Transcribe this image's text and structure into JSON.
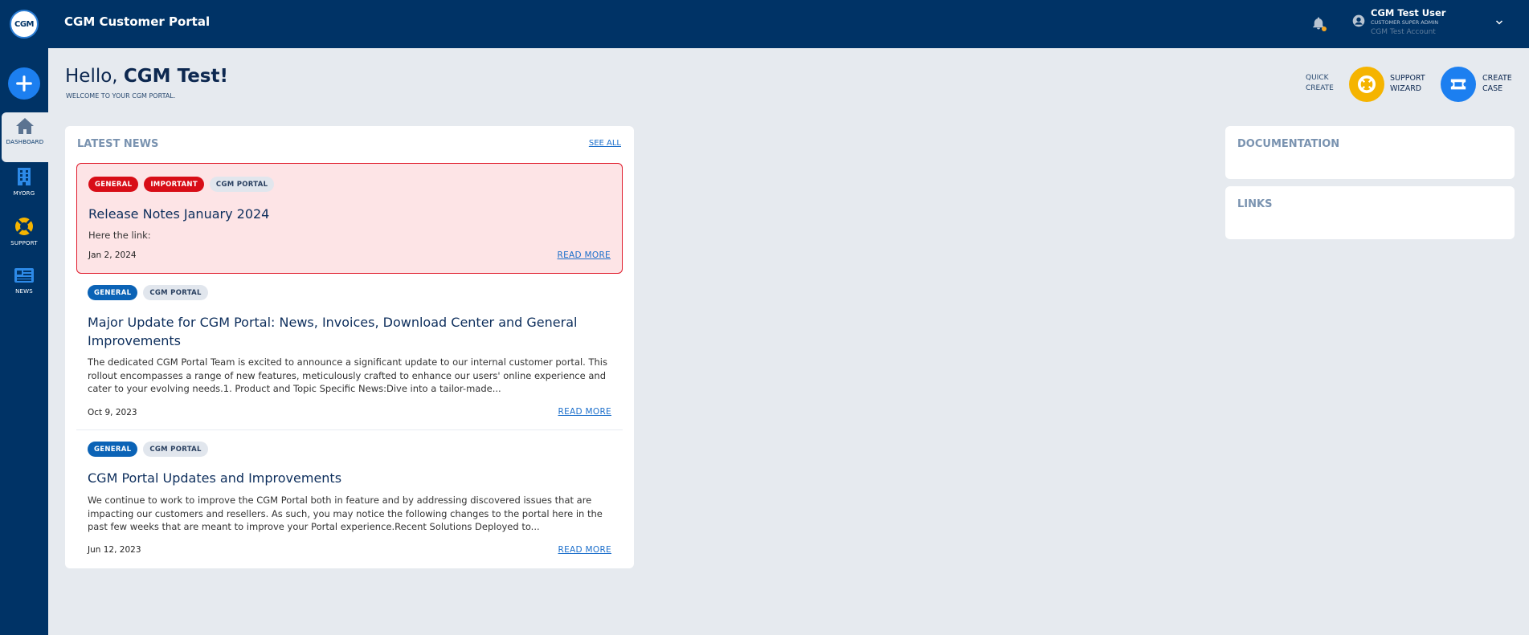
{
  "header": {
    "logo_text": "CGM",
    "app_title": "CGM Customer Portal",
    "user": {
      "name": "CGM Test User",
      "role": "CUSTOMER SUPER ADMIN",
      "account": "CGM Test Account"
    },
    "icons": [
      "bell-icon",
      "user-circle-icon",
      "chevron-down-icon"
    ],
    "notification_dot_color": "#f5a623"
  },
  "sidebar": {
    "items": [
      {
        "label": "DASHBOARD",
        "icon": "home-icon",
        "active": true
      },
      {
        "label": "MYORG",
        "icon": "building-icon",
        "active": false
      },
      {
        "label": "SUPPORT",
        "icon": "lifebuoy-icon",
        "active": false
      },
      {
        "label": "NEWS",
        "icon": "newspaper-icon",
        "active": false
      }
    ]
  },
  "greeting": {
    "hello": "Hello, ",
    "name": "CGM Test!",
    "welcome": "WELCOME TO YOUR CGM PORTAL."
  },
  "quick_create": {
    "label_line1": "QUICK",
    "label_line2": "CREATE",
    "actions": [
      {
        "line1": "SUPPORT",
        "line2": "WIZARD",
        "color": "#f5b400",
        "icon": "lifebuoy-icon"
      },
      {
        "line1": "CREATE",
        "line2": "CASE",
        "color": "#1c7ff0",
        "icon": "ticket-icon"
      }
    ]
  },
  "news": {
    "title": "LATEST NEWS",
    "see_all": "SEE ALL",
    "read_more": "READ MORE",
    "items": [
      {
        "badges": [
          {
            "text": "GENERAL",
            "style": "red"
          },
          {
            "text": "IMPORTANT",
            "style": "red"
          },
          {
            "text": "CGM PORTAL",
            "style": "grey"
          }
        ],
        "title": "Release Notes January 2024",
        "body": "Here the link:",
        "date": "Jan 2, 2024",
        "highlighted": true
      },
      {
        "badges": [
          {
            "text": "GENERAL",
            "style": "blue"
          },
          {
            "text": "CGM PORTAL",
            "style": "grey"
          }
        ],
        "title": "Major Update for CGM Portal: News, Invoices, Download Center and General Improvements",
        "body": "The dedicated CGM Portal Team is excited to announce a significant update to our internal customer portal. This rollout encompasses a range of new features, meticulously crafted to enhance our users' online experience and cater to your evolving needs.1. Product and Topic Specific News:Dive into a tailor-made...",
        "date": "Oct 9, 2023",
        "highlighted": false
      },
      {
        "badges": [
          {
            "text": "GENERAL",
            "style": "blue"
          },
          {
            "text": "CGM PORTAL",
            "style": "grey"
          }
        ],
        "title": "CGM Portal Updates and Improvements",
        "body": "We continue to work to improve the CGM Portal both in feature and by addressing discovered issues that are impacting our customers and resellers. As such, you may notice the following changes to the portal here in the past few weeks that are meant to improve your Portal experience.Recent Solutions Deployed to...",
        "date": "Jun 12, 2023",
        "highlighted": false
      }
    ]
  },
  "documentation": {
    "title": "DOCUMENTATION"
  },
  "links": {
    "title": "LINKS"
  },
  "colors": {
    "header_bg": "#003366",
    "page_bg": "#e6eaef",
    "important_red": "#d80d17",
    "general_blue": "#0b63b6",
    "highlight_bg": "#fde4e6"
  }
}
